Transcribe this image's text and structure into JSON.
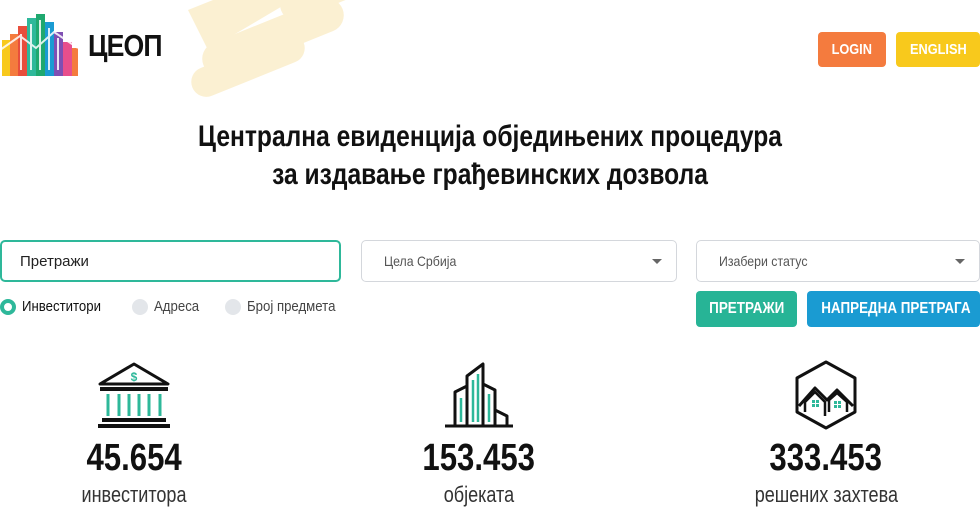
{
  "brand": {
    "name": "ЦЕОП",
    "colors": {
      "teal": "#2eb89a",
      "blue": "#1a9bd2",
      "orange": "#f47b3e",
      "yellow": "#f8c91c",
      "blob": "#fbf0d2"
    }
  },
  "header": {
    "login_label": "LOGIN",
    "language_label": "ENGLISH"
  },
  "headline": {
    "line1": "Централна евиденција обједињених процедура",
    "line2": "за издавање грађевинских дозвола"
  },
  "search": {
    "placeholder": "Претражи",
    "region_select": {
      "value": "Цела Србија",
      "icon": "chevron-down-icon"
    },
    "status_select": {
      "value": "Изабери статус",
      "icon": "chevron-down-icon"
    },
    "search_by": [
      {
        "label": "Инвеститори",
        "selected": true
      },
      {
        "label": "Адреса",
        "selected": false
      },
      {
        "label": "Број предмета",
        "selected": false
      }
    ],
    "search_button": "ПРЕТРАЖИ",
    "advanced_button": "НАПРЕДНА ПРЕТРАГА"
  },
  "stats": [
    {
      "value": "45.654",
      "label": "инвеститора",
      "icon": "bank-icon"
    },
    {
      "value": "153.453",
      "label": "објеката",
      "icon": "buildings-icon"
    },
    {
      "value": "333.453",
      "label": "решених захтева",
      "icon": "houses-icon"
    }
  ]
}
